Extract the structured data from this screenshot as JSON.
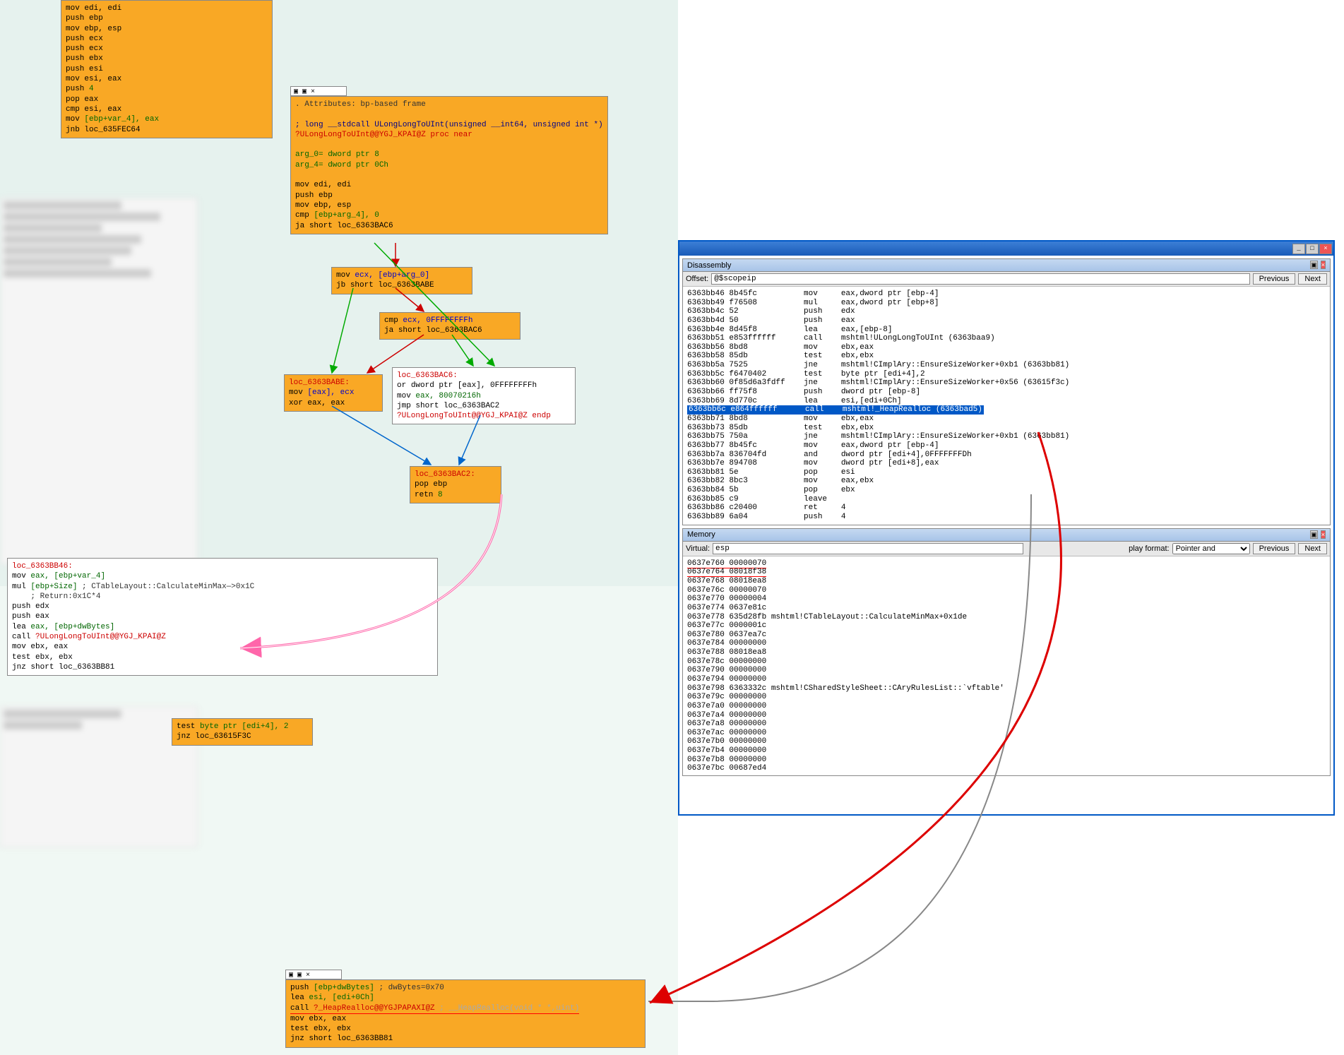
{
  "ida": {
    "block_a": {
      "lines": [
        {
          "op": "mov",
          "args": "edi, edi"
        },
        {
          "op": "push",
          "args": "ebp"
        },
        {
          "op": "mov",
          "args": "ebp, esp"
        },
        {
          "op": "push",
          "args": "ecx"
        },
        {
          "op": "push",
          "args": "ecx"
        },
        {
          "op": "push",
          "args": "ebx"
        },
        {
          "op": "push",
          "args": "esi"
        },
        {
          "op": "mov",
          "args": "esi, eax"
        },
        {
          "op": "push",
          "args": "4"
        },
        {
          "op": "pop",
          "args": "eax"
        },
        {
          "op": "cmp",
          "args": "esi, eax"
        },
        {
          "op": "mov",
          "args": "[ebp+var_4], eax",
          "cls": "green"
        },
        {
          "op": "jnb",
          "args": "loc_635FEC64"
        }
      ]
    },
    "block_b": {
      "attr": ". Attributes: bp-based frame",
      "sig": "; long __stdcall ULongLongToUInt(unsigned __int64, unsigned int *)",
      "name": "?ULongLongToUInt@@YGJ_KPAI@Z proc near",
      "args": [
        "arg_0= dword ptr  8",
        "arg_4= dword ptr  0Ch"
      ],
      "lines": [
        {
          "op": "mov",
          "args": "edi, edi"
        },
        {
          "op": "push",
          "args": "ebp"
        },
        {
          "op": "mov",
          "args": "ebp, esp"
        },
        {
          "op": "cmp",
          "args": "[ebp+arg_4], 0",
          "cls": "green"
        },
        {
          "op": "ja",
          "args": "short loc_6363BAC6"
        }
      ]
    },
    "block_c": {
      "lines": [
        {
          "op": "mov",
          "args": "ecx, [ebp+arg_0]",
          "cls": "green"
        },
        {
          "op": "jb",
          "args": "short loc_6363BABE"
        }
      ]
    },
    "block_d": {
      "lines": [
        {
          "op": "cmp",
          "args": "ecx, 0FFFFFFFFh",
          "cls": "green"
        },
        {
          "op": "ja",
          "args": "short loc_6363BAC6"
        }
      ]
    },
    "block_e": {
      "label": "loc_6363BABE:",
      "lines": [
        {
          "op": "mov",
          "args": "[eax], ecx",
          "cls": "blue"
        },
        {
          "op": "xor",
          "args": "eax, eax"
        }
      ]
    },
    "block_f": {
      "label": "loc_6363BAC6:",
      "lines": [
        {
          "op": "or",
          "args": "dword ptr [eax], 0FFFFFFFFh"
        },
        {
          "op": "mov",
          "args": "eax, 80070216h",
          "cls": "green"
        },
        {
          "op": "jmp",
          "args": "short loc_6363BAC2"
        },
        {
          "op": "",
          "args": "?ULongLongToUInt@@YGJ_KPAI@Z endp",
          "cls": "red"
        }
      ]
    },
    "block_g": {
      "label": "loc_6363BAC2:",
      "lines": [
        {
          "op": "pop",
          "args": "ebp"
        },
        {
          "op": "retn",
          "args": "8",
          "cls": "green"
        }
      ]
    },
    "block_h": {
      "label": "loc_6363BB46:",
      "lines": [
        {
          "op": "mov",
          "args": "eax, [ebp+var_4]",
          "cls": "green"
        },
        {
          "op": "mul",
          "args": "[ebp+Size]",
          "comment": "; CTableLayout::CalculateMinMax—>0x1C",
          "cls": "green"
        },
        {
          "op": "",
          "args": "",
          "comment": "; Return:0x1C*4"
        },
        {
          "op": "push",
          "args": "edx"
        },
        {
          "op": "push",
          "args": "eax"
        },
        {
          "op": "lea",
          "args": "eax, [ebp+dwBytes]",
          "cls": "green"
        },
        {
          "op": "call",
          "args": "?ULongLongToUInt@@YGJ_KPAI@Z",
          "cls": "red"
        },
        {
          "op": "mov",
          "args": "ebx, eax"
        },
        {
          "op": "test",
          "args": "ebx, ebx"
        },
        {
          "op": "jnz",
          "args": "short loc_6363BB81"
        }
      ]
    },
    "block_i": {
      "lines": [
        {
          "op": "test",
          "args": "byte ptr [edi+4], 2",
          "cls": "green"
        },
        {
          "op": "jnz",
          "args": "loc_63615F3C"
        }
      ]
    },
    "block_j": {
      "lines": [
        {
          "op": "push",
          "args": "[ebp+dwBytes]",
          "comment": "; dwBytes=0x70",
          "cls": "green"
        },
        {
          "op": "lea",
          "args": "esi, [edi+0Ch]",
          "cls": "green"
        },
        {
          "op": "call",
          "args": "?_HeapRealloc@@YGJPAPAXI@Z",
          "comment": "; __HeapRealloc(void * *,uint)",
          "cls": "red"
        },
        {
          "op": "mov",
          "args": "ebx, eax"
        },
        {
          "op": "test",
          "args": "ebx, ebx"
        },
        {
          "op": "jnz",
          "args": "short loc_6363BB81"
        }
      ]
    }
  },
  "windbg": {
    "disasm": {
      "title": "Disassembly",
      "offset_label": "Offset:",
      "offset_value": "@$scopeip",
      "prev": "Previous",
      "next": "Next",
      "lines": [
        "6363bb46 8b45fc          mov     eax,dword ptr [ebp-4]",
        "6363bb49 f76508          mul     eax,dword ptr [ebp+8]",
        "6363bb4c 52              push    edx",
        "6363bb4d 50              push    eax",
        "6363bb4e 8d45f8          lea     eax,[ebp-8]",
        "6363bb51 e853ffffff      call    mshtml!ULongLongToUInt (6363baa9)",
        "6363bb56 8bd8            mov     ebx,eax",
        "6363bb58 85db            test    ebx,ebx",
        "6363bb5a 7525            jne     mshtml!CImplAry::EnsureSizeWorker+0xb1 (6363bb81)",
        "6363bb5c f6470402        test    byte ptr [edi+4],2",
        "6363bb60 0f85d6a3fdff    jne     mshtml!CImplAry::EnsureSizeWorker+0x56 (63615f3c)",
        "6363bb66 ff75f8          push    dword ptr [ebp-8]",
        "6363bb69 8d770c          lea     esi,[edi+0Ch]"
      ],
      "highlight": "6363bb6c e864ffffff      call    mshtml!_HeapRealloc (6363bad5)",
      "lines2": [
        "6363bb71 8bd8            mov     ebx,eax",
        "6363bb73 85db            test    ebx,ebx",
        "6363bb75 750a            jne     mshtml!CImplAry::EnsureSizeWorker+0xb1 (6363bb81)",
        "6363bb77 8b45fc          mov     eax,dword ptr [ebp-4]",
        "6363bb7a 836704fd        and     dword ptr [edi+4],0FFFFFFFDh",
        "6363bb7e 894708          mov     dword ptr [edi+8],eax",
        "6363bb81 5e              pop     esi",
        "6363bb82 8bc3            mov     eax,ebx",
        "6363bb84 5b              pop     ebx",
        "6363bb85 c9              leave",
        "6363bb86 c20400          ret     4",
        "6363bb89 6a04            push    4"
      ]
    },
    "memory": {
      "title": "Memory",
      "virtual_label": "Virtual:",
      "virtual_value": "esp",
      "format_label": "play format:",
      "format_value": "Pointer and  ",
      "prev": "Previous",
      "next": "Next",
      "lines": [
        "0637e760 00000070",
        "0637e764 08018f38",
        "0637e768 08018ea8",
        "0637e76c 00000070",
        "0637e770 00000004",
        "0637e774 0637e81c",
        "0637e778 635d28fb mshtml!CTableLayout::CalculateMinMax+0x1de",
        "0637e77c 0000001c",
        "0637e780 0637ea7c",
        "0637e784 00000000",
        "0637e788 08018ea8",
        "0637e78c 00000000",
        "0637e790 00000000",
        "0637e794 00000000",
        "0637e798 6363332c mshtml!CSharedStyleSheet::CAryRulesList::`vftable'",
        "0637e79c 00000000",
        "0637e7a0 00000000",
        "0637e7a4 00000000",
        "0637e7a8 00000000",
        "0637e7ac 00000000",
        "0637e7b0 00000000",
        "0637e7b4 00000000",
        "0637e7b8 00000000",
        "0637e7bc 00687ed4"
      ]
    }
  }
}
